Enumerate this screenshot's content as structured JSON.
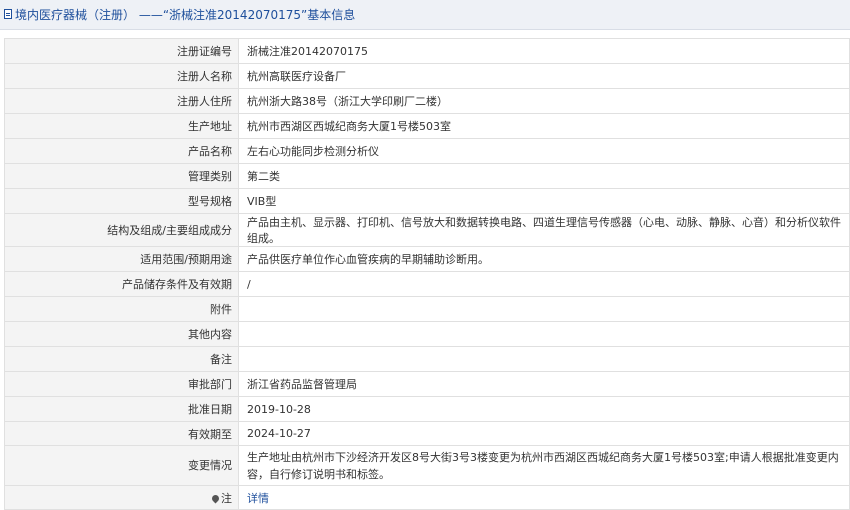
{
  "header": {
    "title": "境内医疗器械（注册） ——“浙械注准20142070175”基本信息"
  },
  "rows": [
    {
      "label": "注册证编号",
      "value": "浙械注准20142070175"
    },
    {
      "label": "注册人名称",
      "value": "杭州高联医疗设备厂"
    },
    {
      "label": "注册人住所",
      "value": "杭州浙大路38号（浙江大学印刷厂二楼）"
    },
    {
      "label": "生产地址",
      "value": "杭州市西湖区西城纪商务大厦1号楼503室"
    },
    {
      "label": "产品名称",
      "value": "左右心功能同步检测分析仪"
    },
    {
      "label": "管理类别",
      "value": "第二类"
    },
    {
      "label": "型号规格",
      "value": "VIB型"
    },
    {
      "label": "结构及组成/主要组成成分",
      "value": "产品由主机、显示器、打印机、信号放大和数据转换电路、四道生理信号传感器（心电、动脉、静脉、心音）和分析仪软件组成。"
    },
    {
      "label": "适用范围/预期用途",
      "value": "产品供医疗单位作心血管疾病的早期辅助诊断用。"
    },
    {
      "label": "产品储存条件及有效期",
      "value": "/"
    },
    {
      "label": "附件",
      "value": ""
    },
    {
      "label": "其他内容",
      "value": ""
    },
    {
      "label": "备注",
      "value": ""
    },
    {
      "label": "审批部门",
      "value": "浙江省药品监督管理局"
    },
    {
      "label": "批准日期",
      "value": "2019-10-28"
    },
    {
      "label": "有效期至",
      "value": "2024-10-27"
    },
    {
      "label": "变更情况",
      "value": "生产地址由杭州市下沙经济开发区8号大街3号3楼变更为杭州市西湖区西城纪商务大厦1号楼503室;申请人根据批准变更内容，自行修订说明书和标签。"
    },
    {
      "label": "注",
      "value": "详情"
    }
  ]
}
